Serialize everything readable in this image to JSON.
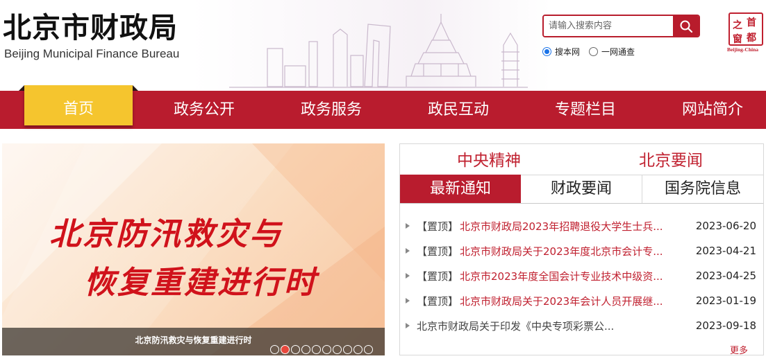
{
  "header": {
    "title": "北京市财政局",
    "subtitle": "Beijing Municipal Finance Bureau",
    "search": {
      "placeholder": "请输入搜索内容",
      "value": ""
    },
    "scopes": [
      {
        "label": "搜本网",
        "checked": true
      },
      {
        "label": "一网通查",
        "checked": false
      }
    ],
    "logo": {
      "chars": [
        "首",
        "都",
        "之",
        "窗"
      ],
      "caption": "Beijing-China"
    }
  },
  "nav": {
    "items": [
      {
        "label": "首页",
        "active": true
      },
      {
        "label": "政务公开",
        "active": false
      },
      {
        "label": "政务服务",
        "active": false
      },
      {
        "label": "政民互动",
        "active": false
      },
      {
        "label": "专题栏目",
        "active": false
      },
      {
        "label": "网站简介",
        "active": false
      }
    ]
  },
  "banner": {
    "line1": "北京防汛救灾与",
    "line2": "恢复重建进行时",
    "caption": "北京防汛救灾与恢复重建进行时",
    "slides": 10,
    "active_slide": 2
  },
  "news": {
    "top_tabs": [
      "中央精神",
      "北京要闻"
    ],
    "sub_tabs": [
      {
        "label": "最新通知",
        "active": true
      },
      {
        "label": "财政要闻",
        "active": false
      },
      {
        "label": "国务院信息",
        "active": false
      }
    ],
    "items": [
      {
        "pin": "【置顶】",
        "title": "北京市财政局2023年招聘退役大学生士兵...",
        "date": "2023-06-20"
      },
      {
        "pin": "【置顶】",
        "title": "北京市财政局关于2023年度北京市会计专...",
        "date": "2023-04-21"
      },
      {
        "pin": "【置顶】",
        "title": "北京市2023年度全国会计专业技术中级资...",
        "date": "2023-04-25"
      },
      {
        "pin": "【置顶】",
        "title": "北京市财政局关于2023年会计人员开展继...",
        "date": "2023-01-19"
      },
      {
        "pin": "",
        "title": "北京市财政局关于印发《中央专项彩票公...",
        "date": "2023-09-18"
      }
    ],
    "more": "更多"
  },
  "colors": {
    "brand_red": "#b91c2e",
    "nav_active": "#f5c52e",
    "link_red": "#c0202f"
  }
}
